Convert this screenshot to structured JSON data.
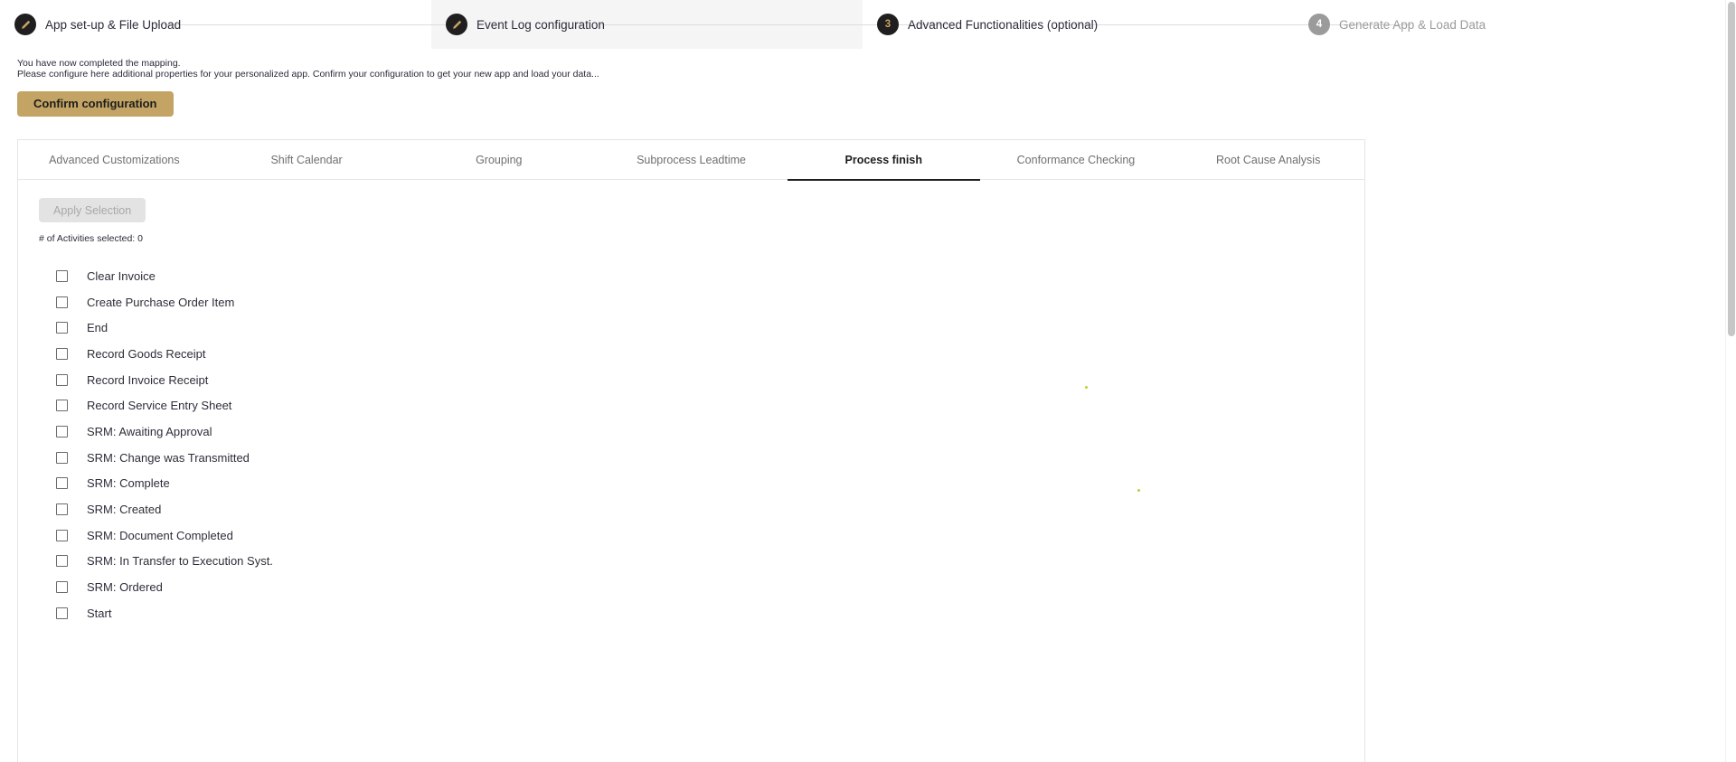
{
  "stepper": {
    "steps": [
      {
        "badge_icon": "pencil-icon",
        "badge_text": "",
        "label": "App set-up & File Upload",
        "state": "done"
      },
      {
        "badge_icon": "pencil-icon",
        "badge_text": "",
        "label": "Event Log configuration",
        "state": "done"
      },
      {
        "badge_icon": "",
        "badge_text": "3",
        "label": "Advanced Functionalities (optional)",
        "state": "current"
      },
      {
        "badge_icon": "",
        "badge_text": "4",
        "label": "Generate App & Load Data",
        "state": "todo"
      }
    ]
  },
  "intro": {
    "line1": "You have now completed the mapping.",
    "line2": "Please configure here additional properties for your personalized app. Confirm your configuration to get your new app and load your data..."
  },
  "confirm_button": {
    "label": "Confirm configuration"
  },
  "tabs": [
    {
      "label": "Advanced Customizations",
      "selected": false
    },
    {
      "label": "Shift Calendar",
      "selected": false
    },
    {
      "label": "Grouping",
      "selected": false
    },
    {
      "label": "Subprocess Leadtime",
      "selected": false
    },
    {
      "label": "Process finish",
      "selected": true
    },
    {
      "label": "Conformance Checking",
      "selected": false
    },
    {
      "label": "Root Cause Analysis",
      "selected": false
    }
  ],
  "panel": {
    "apply_button": {
      "label": "Apply Selection",
      "disabled": true
    },
    "count_text": "# of Activities selected: 0",
    "activities": [
      {
        "label": "Clear Invoice",
        "checked": false
      },
      {
        "label": "Create Purchase Order Item",
        "checked": false
      },
      {
        "label": "End",
        "checked": false
      },
      {
        "label": "Record Goods Receipt",
        "checked": false
      },
      {
        "label": "Record Invoice Receipt",
        "checked": false
      },
      {
        "label": "Record Service Entry Sheet",
        "checked": false
      },
      {
        "label": "SRM: Awaiting Approval",
        "checked": false
      },
      {
        "label": "SRM: Change was Transmitted",
        "checked": false
      },
      {
        "label": "SRM: Complete",
        "checked": false
      },
      {
        "label": "SRM: Created",
        "checked": false
      },
      {
        "label": "SRM: Document Completed",
        "checked": false
      },
      {
        "label": "SRM: In Transfer to Execution Syst.",
        "checked": false
      },
      {
        "label": "SRM: Ordered",
        "checked": false
      },
      {
        "label": "Start",
        "checked": false
      }
    ]
  },
  "colors": {
    "accent_gold": "#c3a464",
    "badge_dark": "#201e1e",
    "badge_inactive": "#9b9b9b",
    "tab_selected_underline": "#1d1d1d",
    "dot_green": "#b5d334"
  }
}
